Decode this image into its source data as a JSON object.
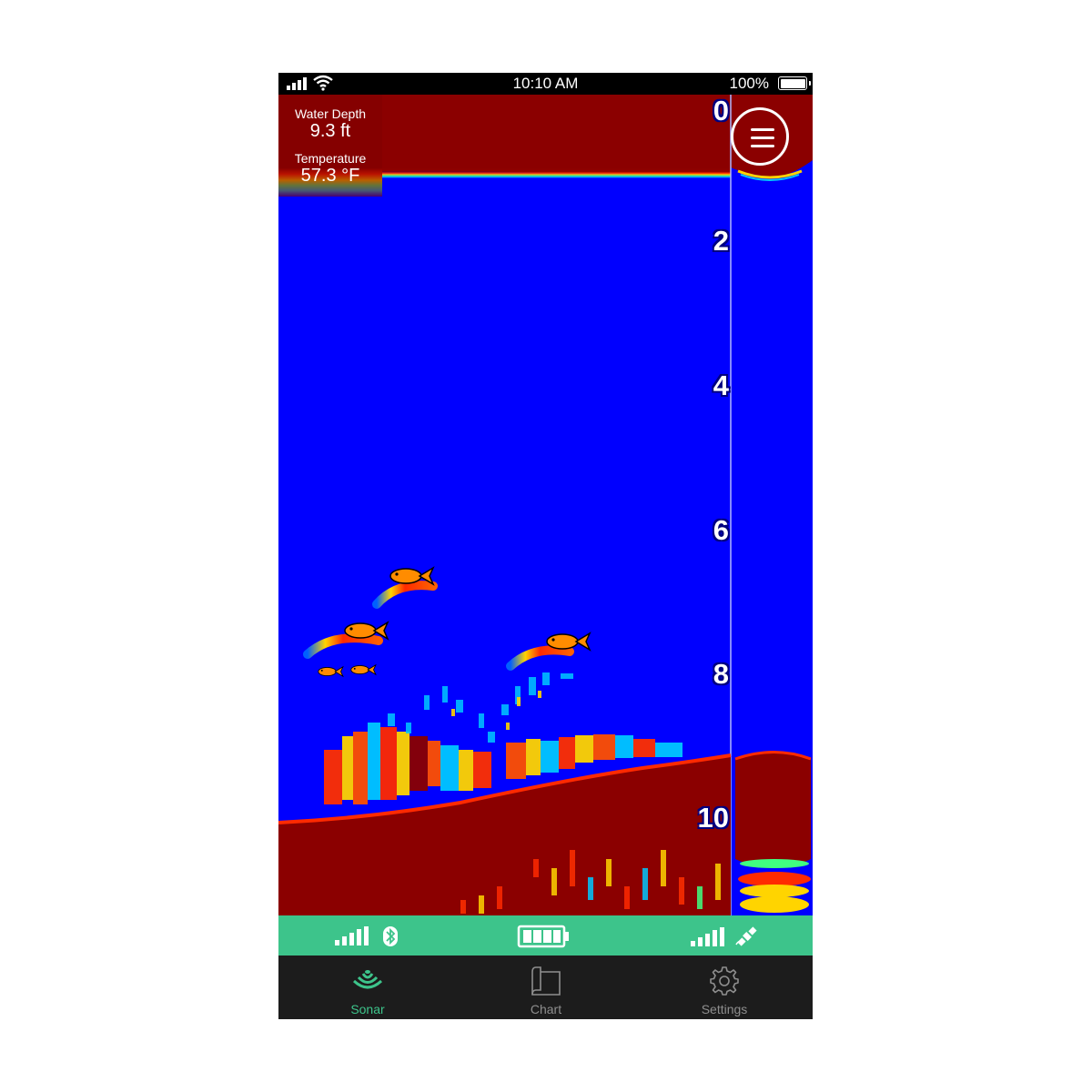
{
  "status_bar": {
    "time": "10:10 AM",
    "battery_percent": "100%",
    "signal": "signal-bars-icon",
    "wifi": "wifi-icon"
  },
  "readout": {
    "water_depth_label": "Water Depth",
    "water_depth_value": "9.3 ft",
    "temperature_label": "Temperature",
    "temperature_value": "57.3 °F"
  },
  "depth_scale": [
    "0",
    "2",
    "4",
    "6",
    "8",
    "10"
  ],
  "menu_button": {
    "icon": "hamburger-menu-icon"
  },
  "connection_bar": {
    "bluetooth_signal": "bluetooth-signal-icon",
    "device_battery": "device-battery-icon",
    "gps_signal": "gps-satellite-icon"
  },
  "tabs": [
    {
      "label": "Sonar",
      "icon": "sonar-icon",
      "active": true
    },
    {
      "label": "Chart",
      "icon": "map-icon",
      "active": false
    },
    {
      "label": "Settings",
      "icon": "gear-icon",
      "active": false
    }
  ],
  "colors": {
    "water": "#0000ff",
    "bottom": "#8b0000",
    "accent": "#3dc48b",
    "fish": "#ff8c00"
  }
}
